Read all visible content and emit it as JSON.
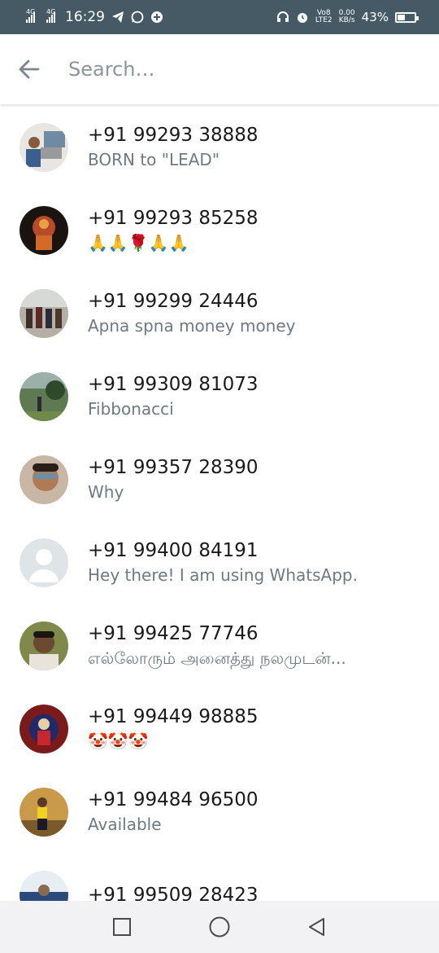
{
  "status_bar": {
    "net1": "4G",
    "net2": "4G",
    "time": "16:29",
    "volte": "Vo8",
    "lte": "LTE2",
    "speed_value": "0.00",
    "speed_unit": "KB/s",
    "battery": "43%",
    "battery_level": 0.43,
    "icons": [
      "signal-icon",
      "telegram-icon",
      "whatsapp-icon",
      "app-icon",
      "headset-icon",
      "alarm-icon",
      "battery-icon"
    ]
  },
  "search": {
    "placeholder": "Search…",
    "value": ""
  },
  "contacts": [
    {
      "name": "+91 99293 38888",
      "status": "BORN to \"LEAD\""
    },
    {
      "name": "+91 99293 85258",
      "status": "🙏🙏🌹🙏🙏"
    },
    {
      "name": "+91 99299 24446",
      "status": "Apna spna money money"
    },
    {
      "name": "+91 99309 81073",
      "status": "Fibbonacci"
    },
    {
      "name": "+91 99357 28390",
      "status": "Why"
    },
    {
      "name": "+91 99400 84191",
      "status": "Hey there! I am using WhatsApp."
    },
    {
      "name": "+91 99425 77746",
      "status": "எல்லோரும் அனைத்து  நலமுடன்..."
    },
    {
      "name": "+91 99449 98885",
      "status": "🤡🤡🤡"
    },
    {
      "name": "+91 99484 96500",
      "status": "Available"
    },
    {
      "name": "+91 99509 28423",
      "status": ""
    }
  ],
  "colors": {
    "status_bar_bg": "#455a64",
    "primary_text": "#1a1a1a",
    "secondary_text": "#6d7a82",
    "placeholder": "#8a959c",
    "nav_bg": "#f2f2f4"
  }
}
